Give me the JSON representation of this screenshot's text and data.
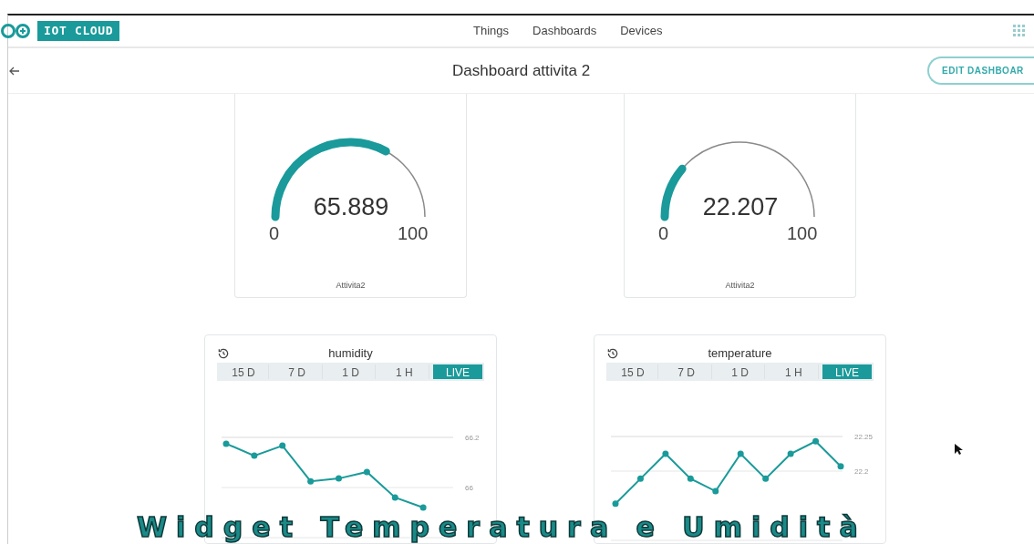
{
  "header": {
    "logo_text": "IOT CLOUD",
    "nav": [
      {
        "label": "Things"
      },
      {
        "label": "Dashboards"
      },
      {
        "label": "Devices"
      }
    ]
  },
  "title_bar": {
    "title": "Dashboard attivita 2",
    "edit_button": "EDIT DASHBOAR"
  },
  "gauges": [
    {
      "value": "65.889",
      "min": "0",
      "max": "100",
      "label": "Attivita2"
    },
    {
      "value": "22.207",
      "min": "0",
      "max": "100",
      "label": "Attivita2"
    }
  ],
  "charts": [
    {
      "ranges": [
        {
          "label": "15 D",
          "selected": false
        },
        {
          "label": "7 D",
          "selected": false
        },
        {
          "label": "1 D",
          "selected": false
        },
        {
          "label": "1 H",
          "selected": false
        },
        {
          "label": "LIVE",
          "selected": true
        }
      ],
      "chart_data": {
        "type": "line",
        "series": [
          {
            "name": "humidity",
            "color": "#1a9a9a",
            "marker": "circle",
            "values": [
              66.175,
              66.127,
              66.167,
              66.025,
              66.036,
              66.062,
              65.96,
              65.92
            ]
          }
        ],
        "ylim": [
          65.8,
          66.2
        ],
        "yticks": [
          66.2,
          66
        ]
      }
    },
    {
      "ranges": [
        {
          "label": "15 D",
          "selected": false
        },
        {
          "label": "7 D",
          "selected": false
        },
        {
          "label": "1 D",
          "selected": false
        },
        {
          "label": "1 H",
          "selected": false
        },
        {
          "label": "LIVE",
          "selected": true
        }
      ],
      "chart_data": {
        "type": "line",
        "series": [
          {
            "name": "temperature",
            "color": "#1a9a9a",
            "marker": "circle",
            "values": [
              22.153,
              22.189,
              22.225,
              22.189,
              22.171,
              22.225,
              22.189,
              22.225,
              22.243,
              22.207
            ]
          }
        ],
        "ylim": [
          22.1,
          22.25
        ],
        "yticks": [
          22.25,
          22.2
        ]
      }
    }
  ],
  "caption": "Widget Temperatura e Umidità"
}
